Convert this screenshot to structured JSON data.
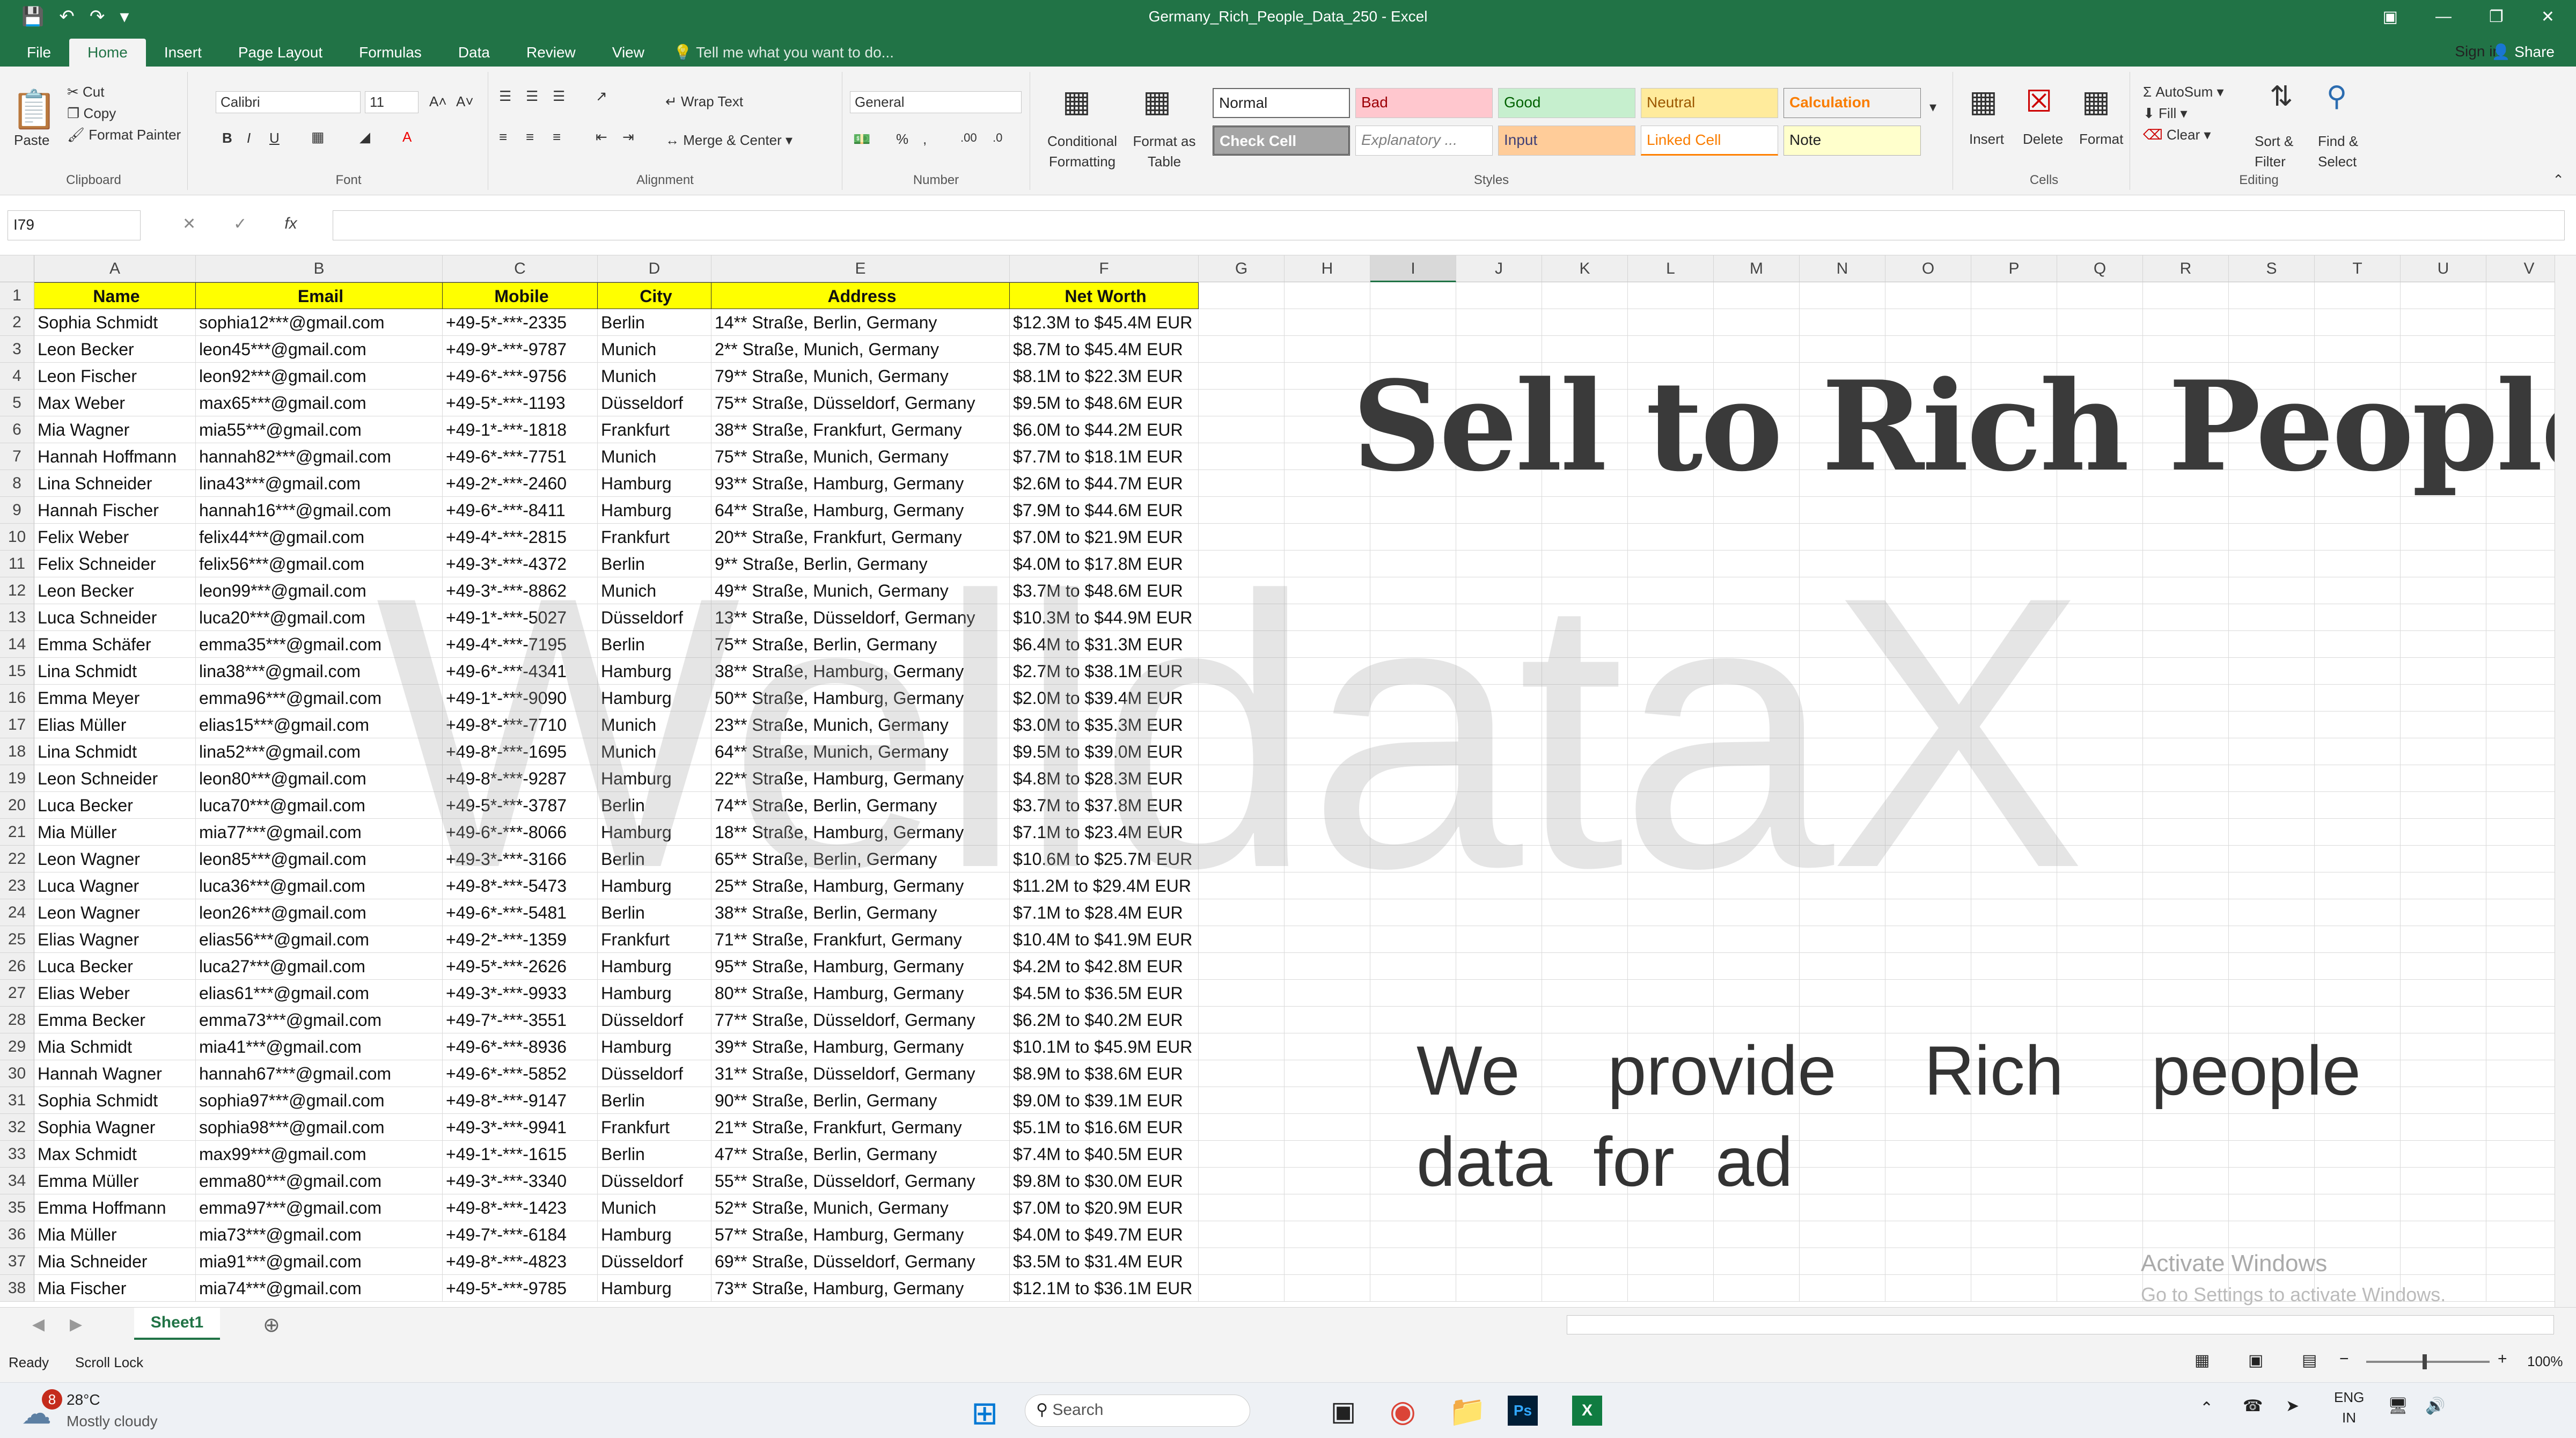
{
  "window": {
    "title": "Germany_Rich_People_Data_250 - Excel",
    "signin": "Sign in",
    "share": "Share"
  },
  "tabs": [
    "File",
    "Home",
    "Insert",
    "Page Layout",
    "Formulas",
    "Data",
    "Review",
    "View"
  ],
  "tellme": "Tell me what you want to do...",
  "ribbon": {
    "clipboard": {
      "paste": "Paste",
      "cut": "Cut",
      "copy": "Copy",
      "format_painter": "Format Painter",
      "label": "Clipboard"
    },
    "font": {
      "name": "Calibri",
      "size": "11",
      "label": "Font"
    },
    "alignment": {
      "wrap": "Wrap Text",
      "merge": "Merge & Center",
      "label": "Alignment"
    },
    "number": {
      "format": "General",
      "label": "Number"
    },
    "styles": {
      "conditional": "Conditional Formatting",
      "format_table": "Format as Table",
      "normal": "Normal",
      "bad": "Bad",
      "good": "Good",
      "neutral": "Neutral",
      "calculation": "Calculation",
      "check": "Check Cell",
      "explanatory": "Explanatory ...",
      "input": "Input",
      "linked": "Linked Cell",
      "note": "Note",
      "label": "Styles"
    },
    "cells": {
      "insert": "Insert",
      "delete": "Delete",
      "format": "Format",
      "label": "Cells"
    },
    "editing": {
      "autosum": "AutoSum",
      "fill": "Fill",
      "clear": "Clear",
      "sort": "Sort & Filter",
      "find": "Find & Select",
      "label": "Editing"
    }
  },
  "namebox": "I79",
  "columns": [
    "A",
    "B",
    "C",
    "D",
    "E",
    "F",
    "G",
    "H",
    "I",
    "J",
    "K",
    "L",
    "M",
    "N",
    "O",
    "P",
    "Q",
    "R",
    "S",
    "T",
    "U",
    "V"
  ],
  "headers": [
    "Name",
    "Email",
    "Mobile",
    "City",
    "Address",
    "Net Worth"
  ],
  "rows": [
    [
      "Sophia Schmidt",
      "sophia12***@gmail.com",
      "+49-5*-***-2335",
      "Berlin",
      "14** Straße, Berlin, Germany",
      "$12.3M to $45.4M EUR"
    ],
    [
      "Leon Becker",
      "leon45***@gmail.com",
      "+49-9*-***-9787",
      "Munich",
      "2** Straße, Munich, Germany",
      "$8.7M to $45.4M EUR"
    ],
    [
      "Leon Fischer",
      "leon92***@gmail.com",
      "+49-6*-***-9756",
      "Munich",
      "79** Straße, Munich, Germany",
      "$8.1M to $22.3M EUR"
    ],
    [
      "Max Weber",
      "max65***@gmail.com",
      "+49-5*-***-1193",
      "Düsseldorf",
      "75** Straße, Düsseldorf, Germany",
      "$9.5M to $48.6M EUR"
    ],
    [
      "Mia Wagner",
      "mia55***@gmail.com",
      "+49-1*-***-1818",
      "Frankfurt",
      "38** Straße, Frankfurt, Germany",
      "$6.0M to $44.2M EUR"
    ],
    [
      "Hannah Hoffmann",
      "hannah82***@gmail.com",
      "+49-6*-***-7751",
      "Munich",
      "75** Straße, Munich, Germany",
      "$7.7M to $18.1M EUR"
    ],
    [
      "Lina Schneider",
      "lina43***@gmail.com",
      "+49-2*-***-2460",
      "Hamburg",
      "93** Straße, Hamburg, Germany",
      "$2.6M to $44.7M EUR"
    ],
    [
      "Hannah Fischer",
      "hannah16***@gmail.com",
      "+49-6*-***-8411",
      "Hamburg",
      "64** Straße, Hamburg, Germany",
      "$7.9M to $44.6M EUR"
    ],
    [
      "Felix Weber",
      "felix44***@gmail.com",
      "+49-4*-***-2815",
      "Frankfurt",
      "20** Straße, Frankfurt, Germany",
      "$7.0M to $21.9M EUR"
    ],
    [
      "Felix Schneider",
      "felix56***@gmail.com",
      "+49-3*-***-4372",
      "Berlin",
      "9** Straße, Berlin, Germany",
      "$4.0M to $17.8M EUR"
    ],
    [
      "Leon Becker",
      "leon99***@gmail.com",
      "+49-3*-***-8862",
      "Munich",
      "49** Straße, Munich, Germany",
      "$3.7M to $48.6M EUR"
    ],
    [
      "Luca Schneider",
      "luca20***@gmail.com",
      "+49-1*-***-5027",
      "Düsseldorf",
      "13** Straße, Düsseldorf, Germany",
      "$10.3M to $44.9M EUR"
    ],
    [
      "Emma Schäfer",
      "emma35***@gmail.com",
      "+49-4*-***-7195",
      "Berlin",
      "75** Straße, Berlin, Germany",
      "$6.4M to $31.3M EUR"
    ],
    [
      "Lina Schmidt",
      "lina38***@gmail.com",
      "+49-6*-***-4341",
      "Hamburg",
      "38** Straße, Hamburg, Germany",
      "$2.7M to $38.1M EUR"
    ],
    [
      "Emma Meyer",
      "emma96***@gmail.com",
      "+49-1*-***-9090",
      "Hamburg",
      "50** Straße, Hamburg, Germany",
      "$2.0M to $39.4M EUR"
    ],
    [
      "Elias Müller",
      "elias15***@gmail.com",
      "+49-8*-***-7710",
      "Munich",
      "23** Straße, Munich, Germany",
      "$3.0M to $35.3M EUR"
    ],
    [
      "Lina Schmidt",
      "lina52***@gmail.com",
      "+49-8*-***-1695",
      "Munich",
      "64** Straße, Munich, Germany",
      "$9.5M to $39.0M EUR"
    ],
    [
      "Leon Schneider",
      "leon80***@gmail.com",
      "+49-8*-***-9287",
      "Hamburg",
      "22** Straße, Hamburg, Germany",
      "$4.8M to $28.3M EUR"
    ],
    [
      "Luca Becker",
      "luca70***@gmail.com",
      "+49-5*-***-3787",
      "Berlin",
      "74** Straße, Berlin, Germany",
      "$3.7M to $37.8M EUR"
    ],
    [
      "Mia Müller",
      "mia77***@gmail.com",
      "+49-6*-***-8066",
      "Hamburg",
      "18** Straße, Hamburg, Germany",
      "$7.1M to $23.4M EUR"
    ],
    [
      "Leon Wagner",
      "leon85***@gmail.com",
      "+49-3*-***-3166",
      "Berlin",
      "65** Straße, Berlin, Germany",
      "$10.6M to $25.7M EUR"
    ],
    [
      "Luca Wagner",
      "luca36***@gmail.com",
      "+49-8*-***-5473",
      "Hamburg",
      "25** Straße, Hamburg, Germany",
      "$11.2M to $29.4M EUR"
    ],
    [
      "Leon Wagner",
      "leon26***@gmail.com",
      "+49-6*-***-5481",
      "Berlin",
      "38** Straße, Berlin, Germany",
      "$7.1M to $28.4M EUR"
    ],
    [
      "Elias Wagner",
      "elias56***@gmail.com",
      "+49-2*-***-1359",
      "Frankfurt",
      "71** Straße, Frankfurt, Germany",
      "$10.4M to $41.9M EUR"
    ],
    [
      "Luca Becker",
      "luca27***@gmail.com",
      "+49-5*-***-2626",
      "Hamburg",
      "95** Straße, Hamburg, Germany",
      "$4.2M to $42.8M EUR"
    ],
    [
      "Elias Weber",
      "elias61***@gmail.com",
      "+49-3*-***-9933",
      "Hamburg",
      "80** Straße, Hamburg, Germany",
      "$4.5M to $36.5M EUR"
    ],
    [
      "Emma Becker",
      "emma73***@gmail.com",
      "+49-7*-***-3551",
      "Düsseldorf",
      "77** Straße, Düsseldorf, Germany",
      "$6.2M to $40.2M EUR"
    ],
    [
      "Mia Schmidt",
      "mia41***@gmail.com",
      "+49-6*-***-8936",
      "Hamburg",
      "39** Straße, Hamburg, Germany",
      "$10.1M to $45.9M EUR"
    ],
    [
      "Hannah Wagner",
      "hannah67***@gmail.com",
      "+49-6*-***-5852",
      "Düsseldorf",
      "31** Straße, Düsseldorf, Germany",
      "$8.9M to $38.6M EUR"
    ],
    [
      "Sophia Schmidt",
      "sophia97***@gmail.com",
      "+49-8*-***-9147",
      "Berlin",
      "90** Straße, Berlin, Germany",
      "$9.0M to $39.1M EUR"
    ],
    [
      "Sophia Wagner",
      "sophia98***@gmail.com",
      "+49-3*-***-9941",
      "Frankfurt",
      "21** Straße, Frankfurt, Germany",
      "$5.1M to $16.6M EUR"
    ],
    [
      "Max Schmidt",
      "max99***@gmail.com",
      "+49-1*-***-1615",
      "Berlin",
      "47** Straße, Berlin, Germany",
      "$7.4M to $40.5M EUR"
    ],
    [
      "Emma Müller",
      "emma80***@gmail.com",
      "+49-3*-***-3340",
      "Düsseldorf",
      "55** Straße, Düsseldorf, Germany",
      "$9.8M to $30.0M EUR"
    ],
    [
      "Emma Hoffmann",
      "emma97***@gmail.com",
      "+49-8*-***-1423",
      "Munich",
      "52** Straße, Munich, Germany",
      "$7.0M to $20.9M EUR"
    ],
    [
      "Mia Müller",
      "mia73***@gmail.com",
      "+49-7*-***-6184",
      "Hamburg",
      "57** Straße, Hamburg, Germany",
      "$4.0M to $49.7M EUR"
    ],
    [
      "Mia Schneider",
      "mia91***@gmail.com",
      "+49-8*-***-4823",
      "Düsseldorf",
      "69** Straße, Düsseldorf, Germany",
      "$3.5M to $31.4M EUR"
    ],
    [
      "Mia Fischer",
      "mia74***@gmail.com",
      "+49-5*-***-9785",
      "Hamburg",
      "73** Straße, Hamburg, Germany",
      "$12.1M to $36.1M EUR"
    ]
  ],
  "overlay": {
    "title": "Sell to Rich People",
    "promo": "We provide Rich people data for ad",
    "watermark": "WelldataX"
  },
  "activate": {
    "line1": "Activate Windows",
    "line2": "Go to Settings to activate Windows."
  },
  "sheet": {
    "tab": "Sheet1"
  },
  "status": {
    "ready": "Ready",
    "scroll_lock": "Scroll Lock",
    "zoom": "100%"
  },
  "taskbar": {
    "weather_temp": "28°C",
    "weather_desc": "Mostly cloudy",
    "weather_badge": "8",
    "search": "Search",
    "lang1": "ENG",
    "lang2": "IN"
  }
}
